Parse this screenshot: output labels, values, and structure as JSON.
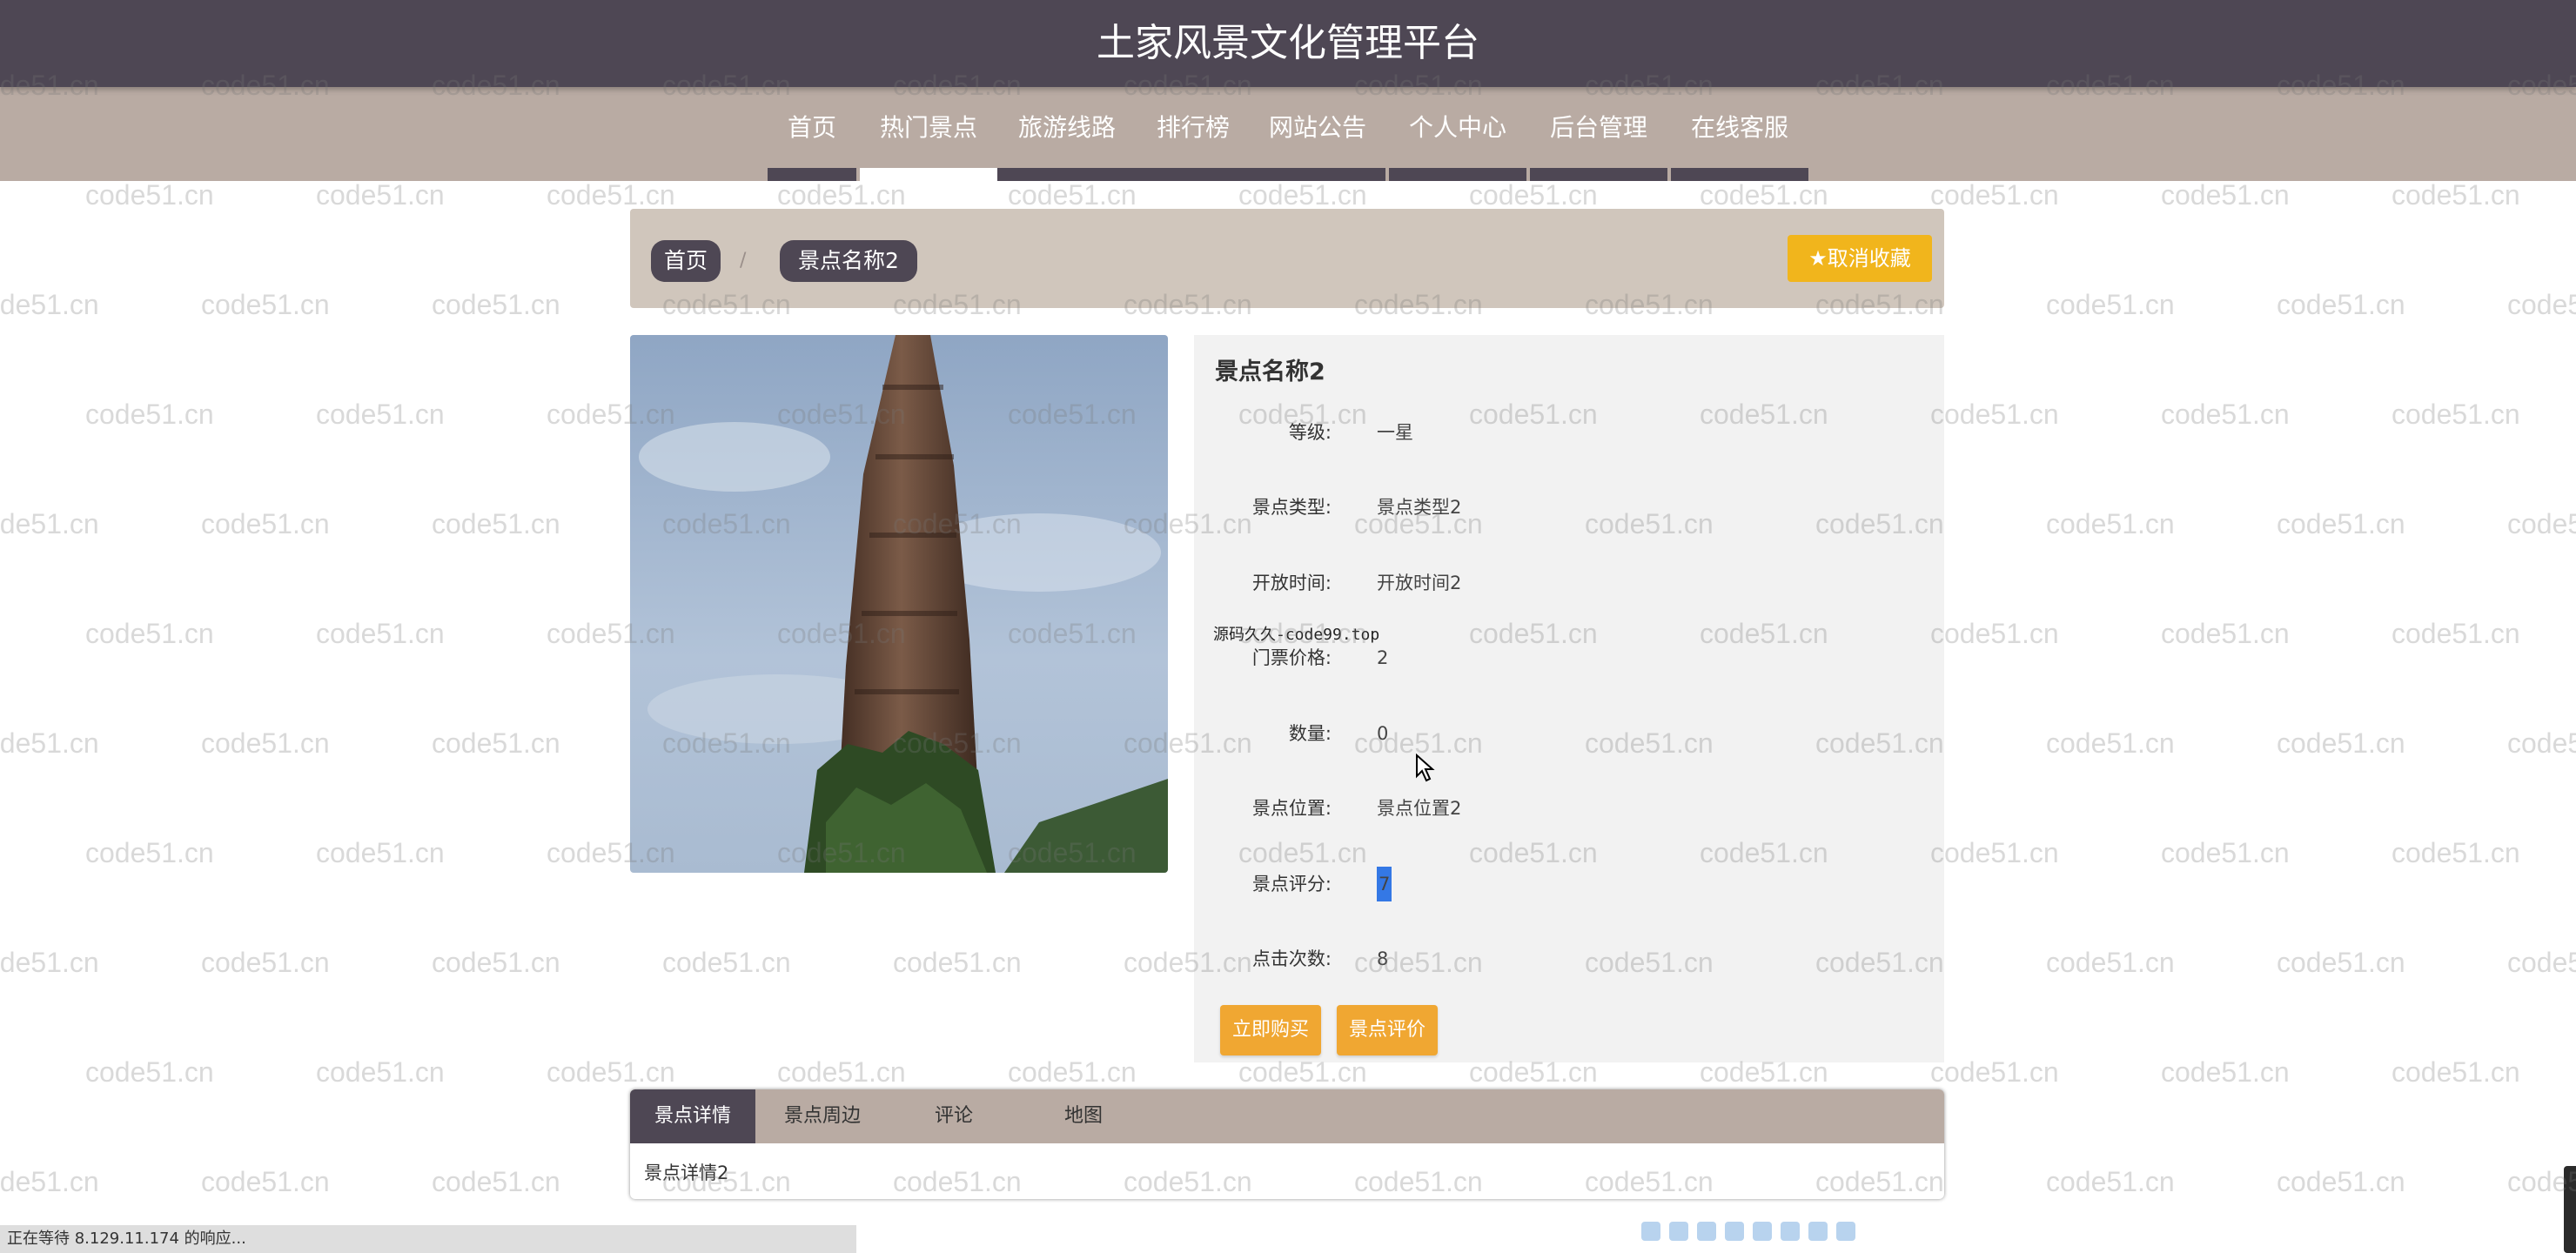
{
  "site": {
    "title": "土家风景文化管理平台"
  },
  "nav": {
    "items": [
      {
        "label": "首页",
        "active": false
      },
      {
        "label": "热门景点",
        "active": true
      },
      {
        "label": "旅游线路",
        "active": false
      },
      {
        "label": "排行榜",
        "active": false
      },
      {
        "label": "网站公告",
        "active": false
      },
      {
        "label": "个人中心",
        "active": false
      },
      {
        "label": "后台管理",
        "active": false
      },
      {
        "label": "在线客服",
        "active": false
      }
    ]
  },
  "breadcrumb": {
    "home": "首页",
    "separator": "/",
    "current": "景点名称2"
  },
  "favorite_button": {
    "label": "取消收藏",
    "icon": "star-icon"
  },
  "detail": {
    "name": "景点名称2",
    "fields": [
      {
        "label": "等级:",
        "value": "一星"
      },
      {
        "label": "景点类型:",
        "value": "景点类型2"
      },
      {
        "label": "开放时间:",
        "value": "开放时间2"
      },
      {
        "label": "门票价格:",
        "value": "2"
      },
      {
        "label": "数量:",
        "value": "0"
      },
      {
        "label": "景点位置:",
        "value": "景点位置2"
      },
      {
        "label": "景点评分:",
        "value": "7"
      },
      {
        "label": "点击次数:",
        "value": "8"
      }
    ],
    "overlay_text": "源码久久-code99.top",
    "buy_button": "立即购买",
    "review_button": "景点评价"
  },
  "tabs": {
    "items": [
      "景点详情",
      "景点周边",
      "评论",
      "地图"
    ],
    "active_index": 0,
    "content": "景点详情2"
  },
  "status_bar": {
    "text": "正在等待 8.129.11.174 的响应..."
  },
  "watermark": {
    "text": "code51.cn"
  },
  "colors": {
    "header": "#4e4754",
    "nav": "#b9aba3",
    "breadcrumb_bar": "#d0c6bc",
    "favorite": "#f1b51c",
    "action": "#f0a732"
  }
}
